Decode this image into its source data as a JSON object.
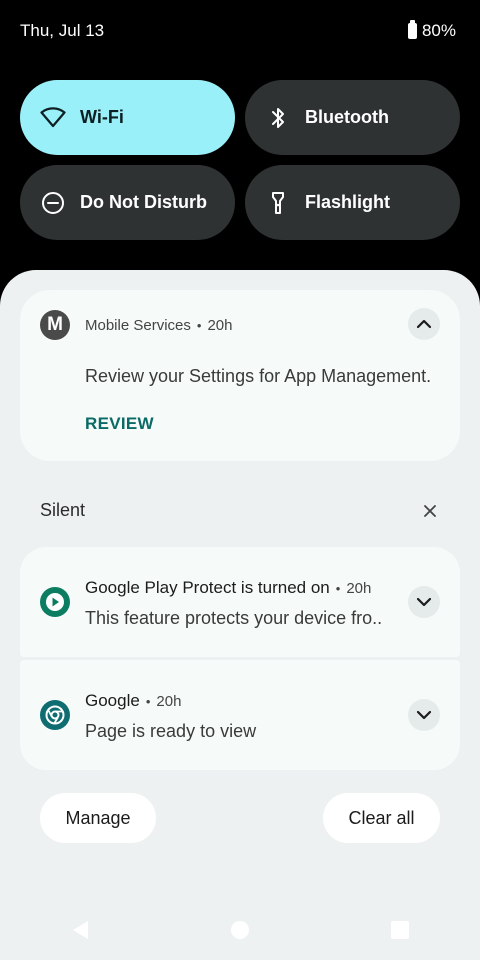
{
  "status_bar": {
    "date": "Thu, Jul 13",
    "battery": "80%"
  },
  "quick_settings": [
    {
      "label": "Wi-Fi",
      "icon": "wifi-icon",
      "active": true
    },
    {
      "label": "Bluetooth",
      "icon": "bluetooth-icon",
      "active": false
    },
    {
      "label": "Do Not Disturb",
      "icon": "do-not-disturb-icon",
      "active": false
    },
    {
      "label": "Flashlight",
      "icon": "flashlight-icon",
      "active": false
    }
  ],
  "notifications": {
    "mobile_services": {
      "badge_letter": "M",
      "app": "Mobile Services",
      "separator": "•",
      "time": "20h",
      "text": "Review your Settings for App Management.",
      "action": "REVIEW"
    },
    "silent_section": {
      "label": "Silent"
    },
    "play_protect": {
      "title": "Google Play Protect is turned on",
      "separator": "•",
      "time": "20h",
      "text": "This feature protects your device fro.."
    },
    "google": {
      "title": "Google",
      "separator": "•",
      "time": "20h",
      "text": "Page is ready to view"
    }
  },
  "actions": {
    "manage": "Manage",
    "clear_all": "Clear all"
  },
  "colors": {
    "active_tile": "#9af0f8",
    "inactive_tile": "#2f3233",
    "review_accent": "#0b6a66",
    "shade_bg": "#eef1f1"
  }
}
